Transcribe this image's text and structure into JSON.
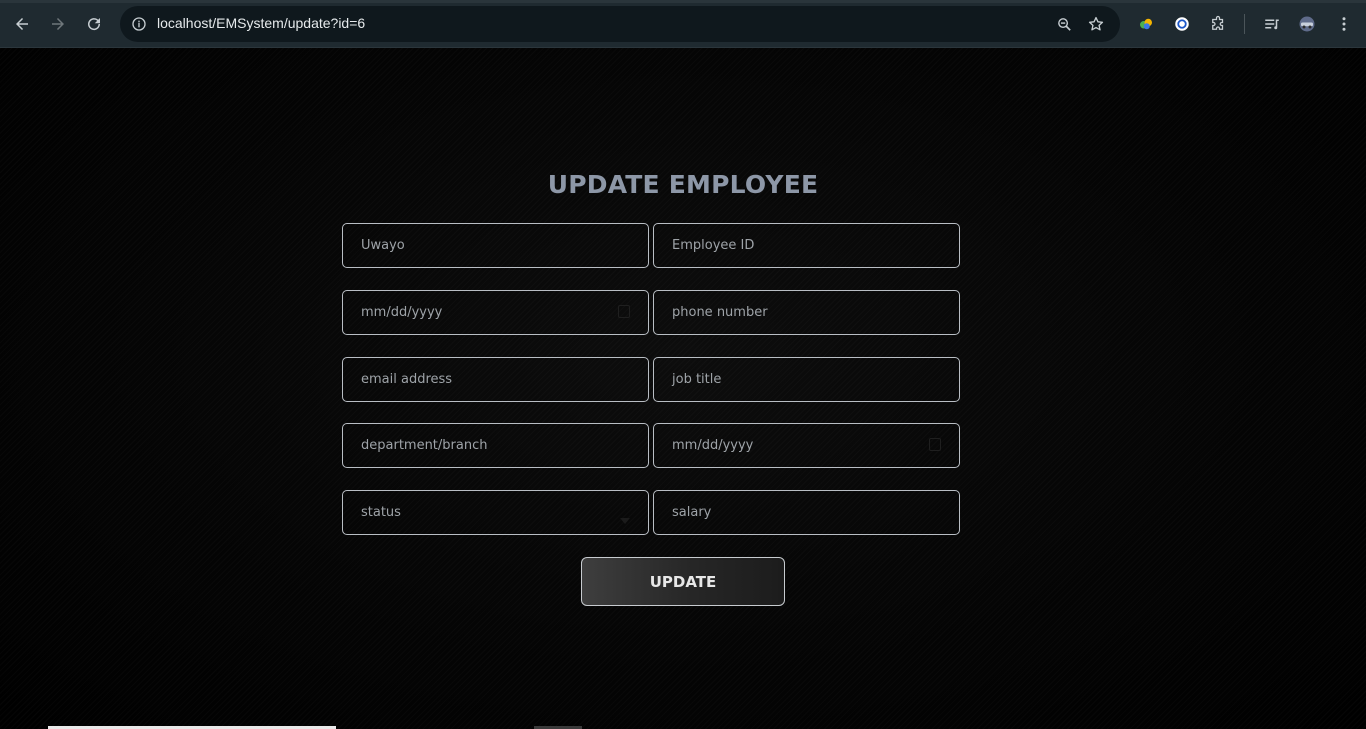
{
  "browser": {
    "url": "localhost/EMSystem/update?id=6"
  },
  "page": {
    "title": "UPDATE EMPLOYEE",
    "fields": [
      {
        "name": "Uwayo"
      },
      {
        "placeholder": "Employee ID"
      },
      {
        "placeholder": "mm/dd/yyyy"
      },
      {
        "placeholder": "phone number"
      },
      {
        "placeholder": "email address"
      },
      {
        "placeholder": "job title"
      },
      {
        "placeholder": "department/branch"
      },
      {
        "placeholder": "mm/dd/yyyy"
      },
      {
        "placeholder": "status"
      },
      {
        "placeholder": "salary"
      }
    ],
    "update_label": "UPDATE"
  },
  "colors": {
    "title": "#8d97a7",
    "field_border": "#b9bec4",
    "toolbar_bg": "#1f2a30"
  }
}
